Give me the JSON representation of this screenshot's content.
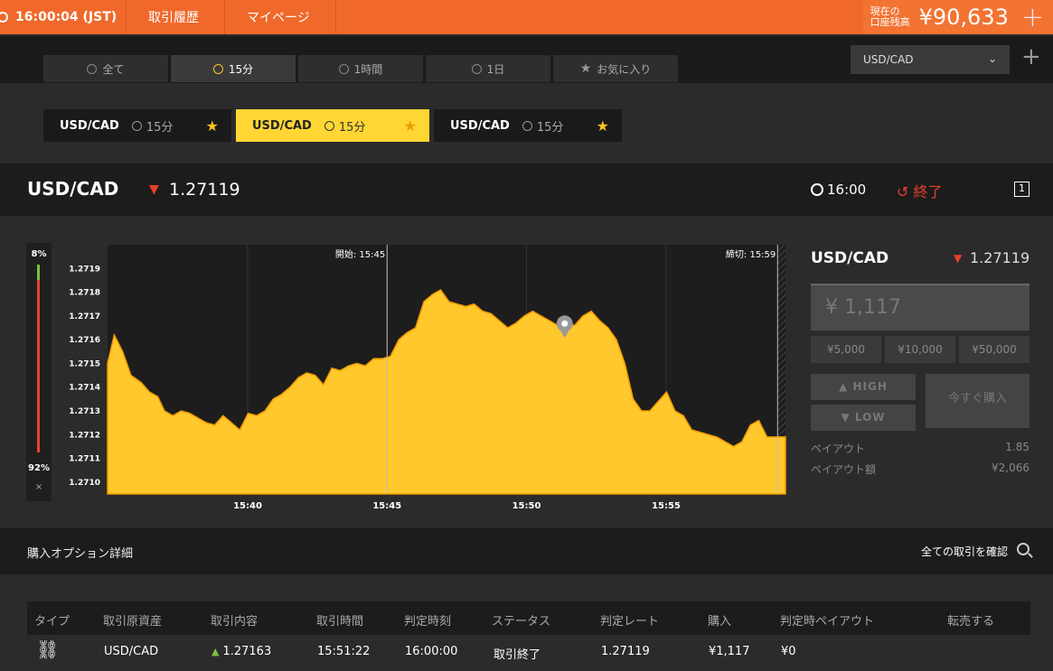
{
  "topbar": {
    "clock": "16:00:04 (JST)",
    "nav": [
      "取引履歴",
      "マイページ"
    ],
    "balance_label_1": "現在の",
    "balance_label_2": "口座残高",
    "balance_amount": "¥90,633",
    "plus": "+"
  },
  "tabs": [
    {
      "label": "全て",
      "icon": "clock-icon"
    },
    {
      "label": "15分",
      "icon": "clock-icon",
      "active": true
    },
    {
      "label": "1時間",
      "icon": "clock-icon"
    },
    {
      "label": "1日",
      "icon": "clock-icon"
    },
    {
      "label": "お気に入り",
      "icon": "star-icon"
    }
  ],
  "pair_select": {
    "value": "USD/CAD"
  },
  "favorites": [
    {
      "pair": "USD/CAD",
      "duration": "15分"
    },
    {
      "pair": "USD/CAD",
      "duration": "15分"
    },
    {
      "pair": "USD/CAD",
      "duration": "15分"
    }
  ],
  "header": {
    "symbol": "USD/CAD",
    "rate": "1.27119",
    "expiry": "16:00",
    "status": "終了",
    "window_icon_label": "1"
  },
  "sentiment": {
    "high_pct": "8%",
    "low_pct": "92%",
    "close": "×",
    "high_fraction": 0.08
  },
  "chart_data": {
    "type": "area",
    "x_ticks": [
      "15:40",
      "15:45",
      "15:50",
      "15:55"
    ],
    "y_ticks": [
      "1.2710",
      "1.2711",
      "1.2712",
      "1.2713",
      "1.2714",
      "1.2715",
      "1.2716",
      "1.2717",
      "1.2718",
      "1.2719"
    ],
    "start_label": "開始: 15:45",
    "end_label": "締切: 15:59",
    "ylim": [
      1.27095,
      1.272
    ],
    "xlim": [
      15.583,
      15.988
    ],
    "color": "#ffc82c",
    "x": [
      15.583,
      15.587,
      15.592,
      15.597,
      15.603,
      15.608,
      15.613,
      15.617,
      15.622,
      15.627,
      15.632,
      15.637,
      15.642,
      15.647,
      15.652,
      15.657,
      15.662,
      15.667,
      15.672,
      15.677,
      15.682,
      15.687,
      15.692,
      15.697,
      15.702,
      15.707,
      15.712,
      15.717,
      15.722,
      15.727,
      15.732,
      15.737,
      15.742,
      15.747,
      15.752,
      15.757,
      15.762,
      15.767,
      15.772,
      15.777,
      15.782,
      15.787,
      15.792,
      15.797,
      15.802,
      15.807,
      15.812,
      15.817,
      15.822,
      15.827,
      15.832,
      15.837,
      15.842,
      15.847,
      15.852,
      15.857,
      15.862,
      15.867,
      15.872,
      15.877,
      15.882,
      15.887,
      15.892,
      15.897,
      15.902,
      15.907,
      15.912,
      15.917,
      15.922,
      15.927,
      15.932,
      15.937,
      15.942,
      15.947,
      15.952,
      15.957,
      15.962,
      15.967,
      15.972,
      15.977,
      15.983,
      15.988
    ],
    "y": [
      1.2715,
      1.27162,
      1.27155,
      1.27145,
      1.27142,
      1.27138,
      1.27136,
      1.2713,
      1.27128,
      1.2713,
      1.27129,
      1.27127,
      1.27125,
      1.27124,
      1.27128,
      1.27125,
      1.27122,
      1.27129,
      1.27128,
      1.2713,
      1.27135,
      1.27137,
      1.2714,
      1.27144,
      1.27146,
      1.27145,
      1.27141,
      1.27148,
      1.27147,
      1.27149,
      1.2715,
      1.27149,
      1.27152,
      1.27152,
      1.27153,
      1.2716,
      1.27163,
      1.27165,
      1.27176,
      1.27179,
      1.27181,
      1.27176,
      1.27175,
      1.27174,
      1.27175,
      1.27172,
      1.27171,
      1.27168,
      1.27165,
      1.27167,
      1.2717,
      1.27172,
      1.2717,
      1.27168,
      1.27166,
      1.27167,
      1.27166,
      1.2717,
      1.27172,
      1.27168,
      1.27165,
      1.2716,
      1.2715,
      1.27135,
      1.2713,
      1.2713,
      1.27134,
      1.27138,
      1.2713,
      1.27128,
      1.27122,
      1.27121,
      1.2712,
      1.27119,
      1.27117,
      1.27115,
      1.27117,
      1.27124,
      1.27126,
      1.27119,
      1.27119,
      1.27119
    ]
  },
  "trade": {
    "symbol": "USD/CAD",
    "rate": "1.27119",
    "amount_placeholder": "¥ 1,117",
    "quick": [
      "¥5,000",
      "¥10,000",
      "¥50,000"
    ],
    "high": "HIGH",
    "low": "LOW",
    "buy_now": "今すぐ購入",
    "payout_label": "ペイアウト",
    "payout_value": "1.85",
    "payout_amount_label": "ペイアウト額",
    "payout_amount_value": "¥2,066"
  },
  "details": {
    "title": "購入オプション詳細",
    "link": "全ての取引を確認"
  },
  "table": {
    "headers": [
      "タイプ",
      "取引原資産",
      "取引内容",
      "取引時間",
      "判定時刻",
      "ステータス",
      "判定レート",
      "購入",
      "判定時ペイアウト",
      "転売する"
    ],
    "row": {
      "asset": "USD/CAD",
      "content": "1.27163",
      "time": "15:51:22",
      "judge_time": "16:00:00",
      "status": "取引終了",
      "judge_rate": "1.27119",
      "purchase": "¥1,117",
      "payout": "¥0"
    }
  }
}
